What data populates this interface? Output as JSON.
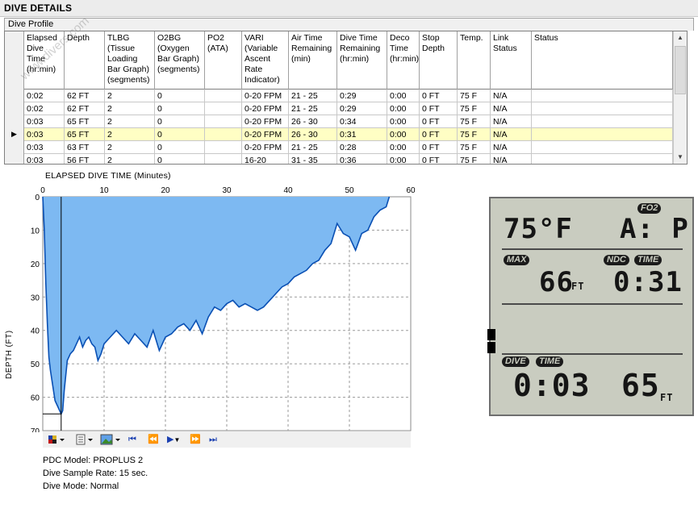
{
  "title": "DIVE DETAILS",
  "tab_label": "Dive Profile",
  "watermark": "www.divers.com",
  "table": {
    "columns": [
      "Elapsed\nDive\nTime\n(hr:min)",
      "Depth",
      "TLBG\n(Tissue\nLoading\nBar Graph)\n(segments)",
      "O2BG\n(Oxygen\nBar Graph)\n(segments)",
      "PO2\n(ATA)",
      "VARI\n(Variable\nAscent\nRate\nIndicator)",
      "Air Time\nRemaining\n(min)",
      "Dive Time\nRemaining\n(hr:min)",
      "Deco\nTime\n(hr:min)",
      "Stop\nDepth",
      "Temp.",
      "Link\nStatus",
      "Status"
    ],
    "rows": [
      [
        "0:02",
        "62 FT",
        "2",
        "0",
        "",
        "0-20 FPM",
        "21 - 25",
        "0:29",
        "0:00",
        "0 FT",
        "75 F",
        "N/A",
        ""
      ],
      [
        "0:02",
        "62 FT",
        "2",
        "0",
        "",
        "0-20 FPM",
        "21 - 25",
        "0:29",
        "0:00",
        "0 FT",
        "75 F",
        "N/A",
        ""
      ],
      [
        "0:03",
        "65 FT",
        "2",
        "0",
        "",
        "0-20 FPM",
        "26 - 30",
        "0:34",
        "0:00",
        "0 FT",
        "75 F",
        "N/A",
        ""
      ],
      [
        "0:03",
        "65 FT",
        "2",
        "0",
        "",
        "0-20 FPM",
        "26 - 30",
        "0:31",
        "0:00",
        "0 FT",
        "75 F",
        "N/A",
        ""
      ],
      [
        "0:03",
        "63 FT",
        "2",
        "0",
        "",
        "0-20 FPM",
        "21 - 25",
        "0:28",
        "0:00",
        "0 FT",
        "75 F",
        "N/A",
        ""
      ],
      [
        "0:03",
        "56 FT",
        "2",
        "0",
        "",
        "16-20",
        "31 - 35",
        "0:36",
        "0:00",
        "0 FT",
        "75 F",
        "N/A",
        ""
      ]
    ],
    "selected_row": 3,
    "row_marker": "▶"
  },
  "chart": {
    "xlabel": "ELAPSED DIVE TIME (Minutes)",
    "ylabel": "DEPTH (FT)",
    "x_ticks": [
      "0",
      "10",
      "20",
      "30",
      "40",
      "50",
      "60"
    ],
    "y_ticks": [
      "0",
      "10",
      "20",
      "30",
      "40",
      "50",
      "60",
      "70"
    ],
    "cursor_time_min": 3.0,
    "cursor_depth_ft": 65
  },
  "chart_data": {
    "type": "area",
    "xlabel": "ELAPSED DIVE TIME (Minutes)",
    "ylabel": "DEPTH (FT)",
    "xlim": [
      0,
      60
    ],
    "ylim": [
      0,
      70
    ],
    "y_inverted": true,
    "grid": true,
    "fill_color": "#7db9f2",
    "line_color": "#0a50b4",
    "x": [
      0,
      0.25,
      0.5,
      0.75,
      1,
      1.25,
      1.5,
      1.75,
      2,
      2.25,
      2.5,
      2.75,
      3,
      3.25,
      3.5,
      4,
      4.5,
      5,
      5.5,
      6,
      6.5,
      7,
      7.5,
      8,
      8.5,
      9,
      9.5,
      10,
      11,
      12,
      13,
      14,
      15,
      16,
      17,
      18,
      19,
      20,
      21,
      22,
      23,
      24,
      25,
      26,
      27,
      28,
      29,
      30,
      31,
      32,
      33,
      34,
      35,
      36,
      37,
      38,
      39,
      40,
      41,
      42,
      43,
      44,
      45,
      46,
      47,
      48,
      49,
      50,
      51,
      52,
      53,
      54,
      55,
      56,
      56.5
    ],
    "y": [
      0,
      10,
      26,
      38,
      48,
      52,
      55,
      58,
      61,
      62,
      63,
      64,
      65,
      64,
      58,
      49,
      47,
      46,
      44,
      42,
      45,
      43,
      42,
      44,
      45,
      49,
      47,
      44,
      42,
      40,
      42,
      44,
      41,
      43,
      45,
      40,
      46,
      42,
      41,
      39,
      38,
      40,
      37,
      41,
      36,
      33,
      34,
      32,
      31,
      33,
      32,
      33,
      34,
      33,
      31,
      29,
      27,
      26,
      24,
      23,
      22,
      20,
      19,
      16,
      14,
      8,
      11,
      12,
      16,
      11,
      10,
      6,
      4,
      3,
      0
    ]
  },
  "pdc_info": {
    "model": "PDC Model: PROPLUS 2",
    "sample_rate": "Dive Sample Rate: 15 sec.",
    "mode": "Dive Mode: Normal"
  },
  "lcd": {
    "fo2_label": "FO2",
    "temp": "75°F",
    "fo2_value": "A: P",
    "max_label": "MAX",
    "max_depth": "66",
    "max_unit": "FT",
    "ndc_label": "NDC",
    "time_label": "TIME",
    "ndc_time": "0:31",
    "dive_label": "DIVE",
    "dive_time_label": "TIME",
    "dive_time": "0:03",
    "depth": "65",
    "depth_unit": "FT"
  }
}
